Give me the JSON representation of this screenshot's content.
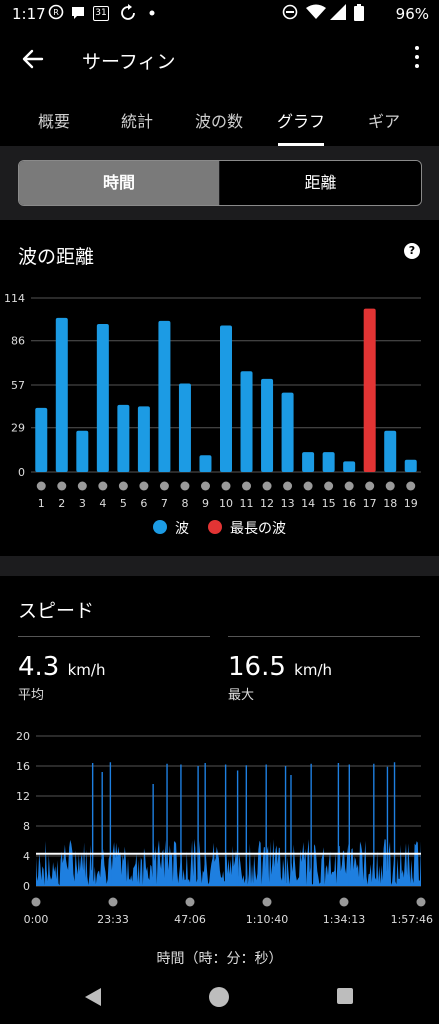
{
  "status_bar": {
    "time": "1:17",
    "calendar_day": "31",
    "battery": "96%"
  },
  "app_bar": {
    "title": "サーフィン"
  },
  "tabs": [
    {
      "label": "概要"
    },
    {
      "label": "統計"
    },
    {
      "label": "波の数"
    },
    {
      "label": "グラフ",
      "active": true
    },
    {
      "label": "ギア"
    }
  ],
  "segmented": {
    "time_label": "時間",
    "distance_label": "距離",
    "selected": "時間"
  },
  "wave_distance": {
    "title": "波の距離",
    "help_glyph": "?",
    "legend": {
      "wave": "波",
      "longest": "最長の波"
    },
    "colors": {
      "wave": "#1c9be4",
      "longest": "#e23434"
    }
  },
  "chart_data": [
    {
      "type": "bar",
      "title": "波の距離",
      "categories": [
        "1",
        "2",
        "3",
        "4",
        "5",
        "6",
        "7",
        "8",
        "9",
        "10",
        "11",
        "12",
        "13",
        "14",
        "15",
        "16",
        "17",
        "18",
        "19"
      ],
      "y_ticks": [
        "0",
        "29",
        "57",
        "86",
        "114"
      ],
      "ylim": [
        0,
        114
      ],
      "grid": true,
      "series": [
        {
          "name": "波",
          "values": [
            42,
            101,
            27,
            97,
            44,
            43,
            99,
            58,
            11,
            96,
            66,
            61,
            52,
            13,
            13,
            7,
            null,
            27,
            8
          ]
        },
        {
          "name": "最長の波",
          "values": [
            null,
            null,
            null,
            null,
            null,
            null,
            null,
            null,
            null,
            null,
            null,
            null,
            null,
            null,
            null,
            null,
            107,
            null,
            null
          ]
        }
      ]
    },
    {
      "type": "area",
      "title": "スピード",
      "y_ticks": [
        "0",
        "4",
        "8",
        "12",
        "16",
        "20"
      ],
      "ylim": [
        0,
        20
      ],
      "x_ticks": [
        "0:00",
        "23:33",
        "47:06",
        "1:10:40",
        "1:34:13",
        "1:57:46"
      ],
      "xlim_seconds": [
        0,
        7066
      ],
      "xlabel": "時間（時：分：秒）",
      "average_kmh": 4.3,
      "max_kmh": 16.5,
      "grid": true,
      "peaks_seconds": [
        1040,
        1215,
        1365,
        2150,
        2405,
        2660,
        2975,
        3105,
        3480,
        3700,
        3860,
        4225,
        4580,
        4680,
        5050,
        5550,
        5750,
        6200,
        6450,
        6580
      ],
      "peak_values_kmh": [
        16.4,
        15.2,
        16.5,
        13.6,
        16.3,
        16.2,
        16.0,
        16.4,
        16.2,
        15.4,
        16.1,
        16.2,
        16.0,
        14.8,
        16.3,
        16.4,
        16.2,
        16.3,
        15.9,
        16.5
      ]
    }
  ],
  "speed": {
    "title": "スピード",
    "avg_value": "4.3",
    "avg_unit": "km/h",
    "avg_label": "平均",
    "max_value": "16.5",
    "max_unit": "km/h",
    "max_label": "最大",
    "fill_color": "#1e7fe0",
    "avg_line_color": "#ffffff"
  }
}
